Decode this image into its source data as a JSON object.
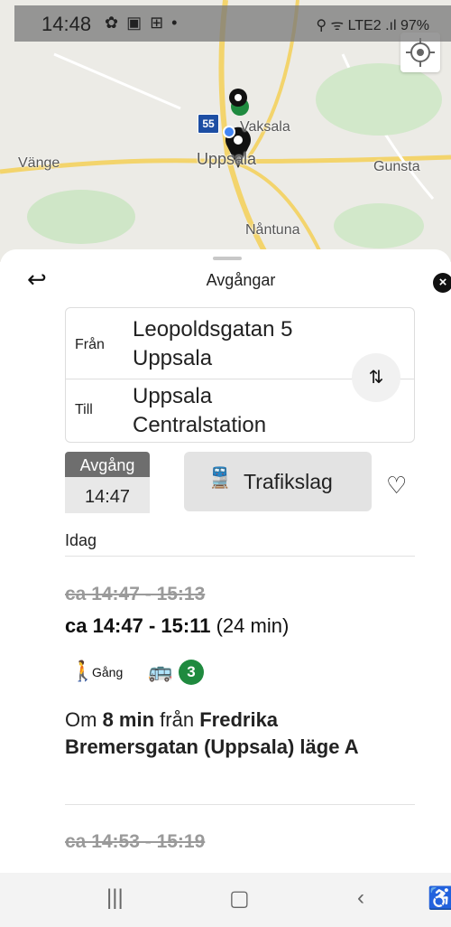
{
  "status_bar": {
    "time": "14:48",
    "left_icons": "✿ ▣ ⊞ •",
    "right_icons": "⚲ ᯤ LTE2 .ıl 97%"
  },
  "map": {
    "labels": {
      "vaksala": "Vaksala",
      "vange": "Vänge",
      "uppsala": "Uppsala",
      "gunsta": "Gunsta",
      "nantuna": "Nåntuna"
    },
    "road_shield": "55"
  },
  "sheet": {
    "title": "Avgångar",
    "from_label": "Från",
    "from_value": [
      "Leopoldsgatan 5",
      "Uppsala"
    ],
    "to_label": "Till",
    "to_value": [
      "Uppsala",
      "Centralstation"
    ],
    "departure_label": "Avgång",
    "departure_time": "14:47",
    "modes_label": "Trafikslag",
    "date_label": "Idag",
    "trips": [
      {
        "original_time": "ca 14:47 - 15:13",
        "time": "ca 14:47 - 15:11",
        "duration": "(24 min)",
        "walk_label": "Gång",
        "line": "3",
        "info": {
          "prefix": "Om",
          "minutes": "8 min",
          "mid": "från",
          "stop": "Fredrika Bremersgatan (Uppsala) läge A"
        }
      },
      {
        "original_time": "ca 14:53 - 15:19"
      }
    ]
  },
  "colors": {
    "line_badge": "#1f8a3f",
    "road_shield": "#1d4ea3"
  }
}
